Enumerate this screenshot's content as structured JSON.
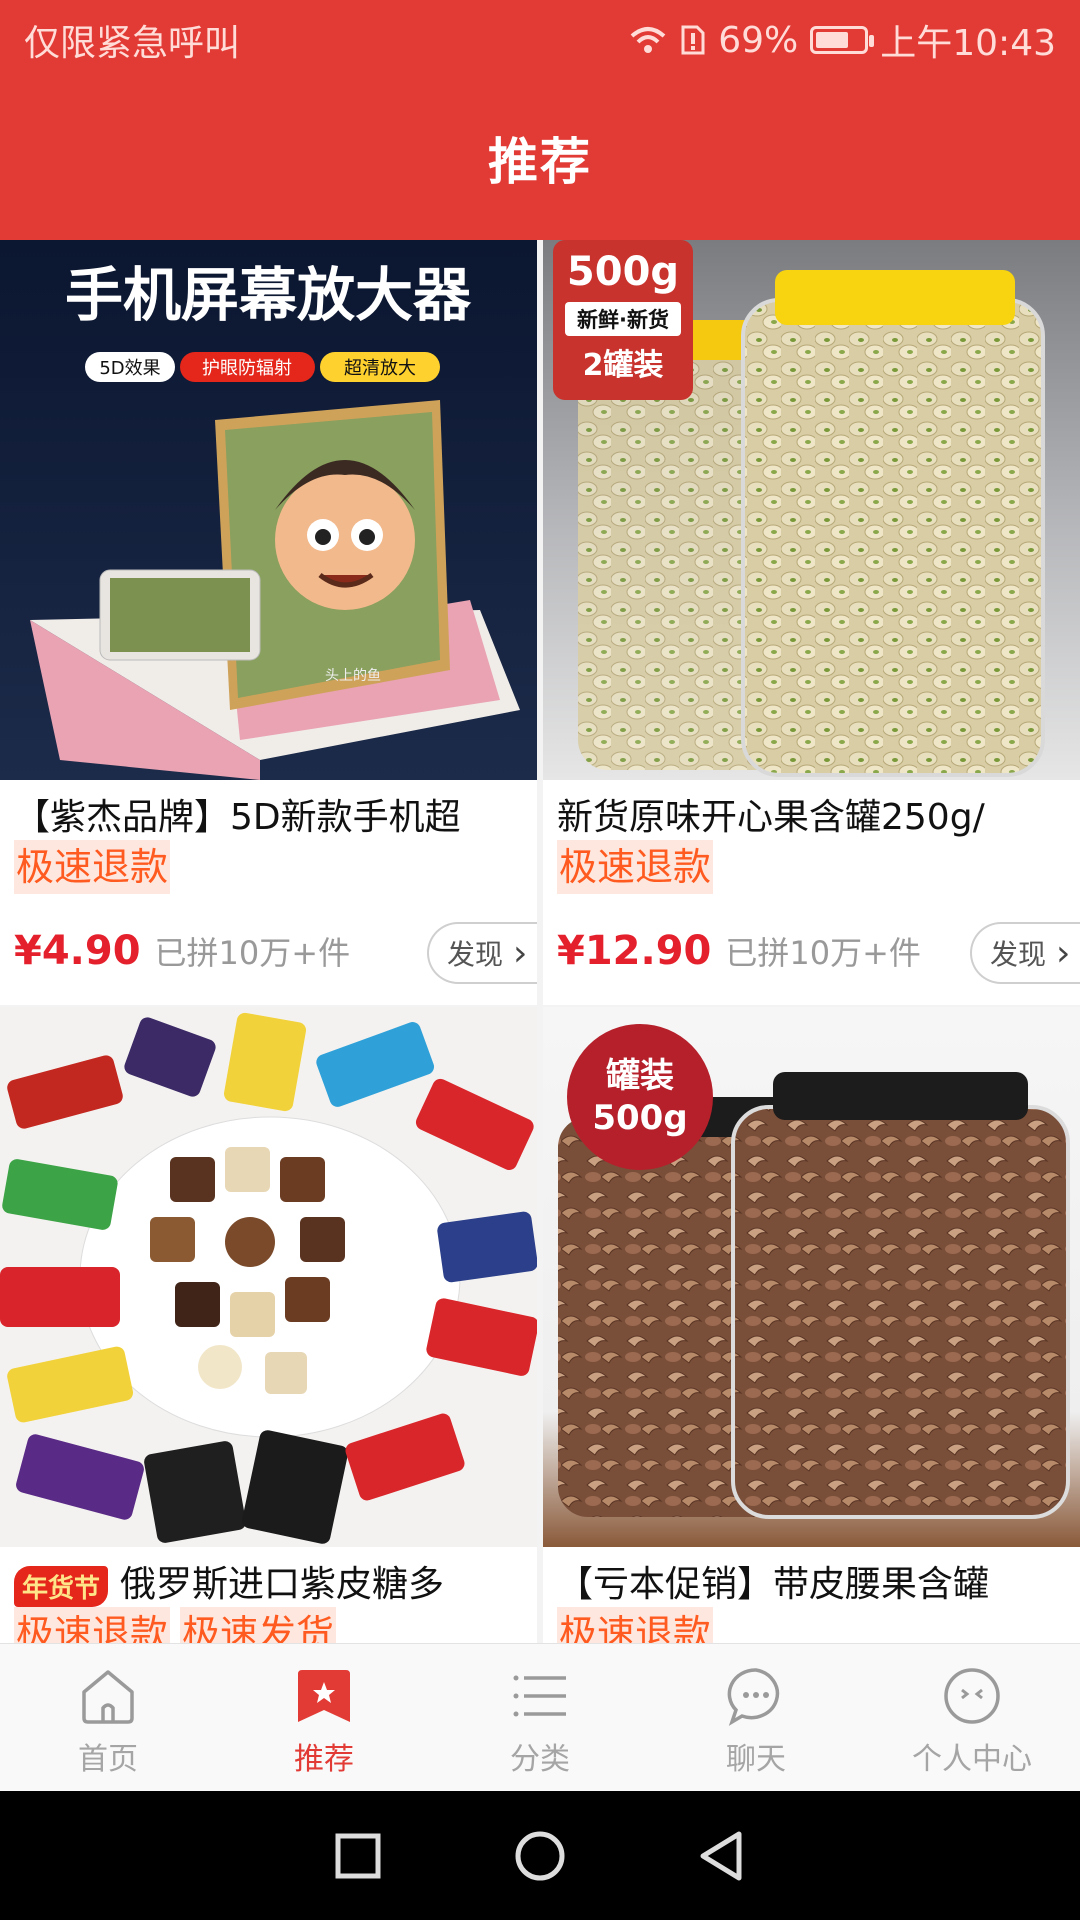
{
  "status": {
    "left_text": "仅限紧急呼叫",
    "battery_percent": "69%",
    "battery_level": 0.69,
    "time": "上午10:43"
  },
  "header": {
    "title": "推荐"
  },
  "colors": {
    "brand": "#e23b35",
    "price": "#e5202d",
    "tag_text": "#ff5a1f",
    "tag_bg": "#fde7df"
  },
  "products": [
    {
      "title": "【紫杰品牌】5D新款手机超",
      "tags": [
        "极速退款"
      ],
      "price": "¥4.90",
      "sold": "已拼10万+件",
      "find_label": "发现",
      "image": {
        "headline": "手机屏幕放大器",
        "chips": [
          "5D效果",
          "护眼防辐射",
          "超清放大"
        ],
        "watermark": "头上的鱼"
      }
    },
    {
      "title": "新货原味开心果含罐250g/",
      "tags": [
        "极速退款"
      ],
      "price": "¥12.90",
      "sold": "已拼10万+件",
      "find_label": "发现",
      "image": {
        "weight": "500g",
        "line1": "新鲜·新货",
        "line2": "2罐装"
      }
    },
    {
      "badge": "年货节",
      "title": "俄罗斯进口紫皮糖多",
      "tags": [
        "极速退款",
        "极速发货"
      ],
      "image": {}
    },
    {
      "title": "【亏本促销】带皮腰果含罐",
      "tags": [
        "极速退款"
      ],
      "image": {
        "line1": "罐装",
        "line2": "500g"
      }
    }
  ],
  "tabs": [
    {
      "label": "首页",
      "icon": "home-icon",
      "active": false
    },
    {
      "label": "推荐",
      "icon": "recommend-icon",
      "active": true
    },
    {
      "label": "分类",
      "icon": "category-list-icon",
      "active": false
    },
    {
      "label": "聊天",
      "icon": "chat-bubble-icon",
      "active": false
    },
    {
      "label": "个人中心",
      "icon": "profile-face-icon",
      "active": false
    }
  ],
  "system_nav": [
    "recent-apps-icon",
    "home-circle-icon",
    "back-triangle-icon"
  ]
}
